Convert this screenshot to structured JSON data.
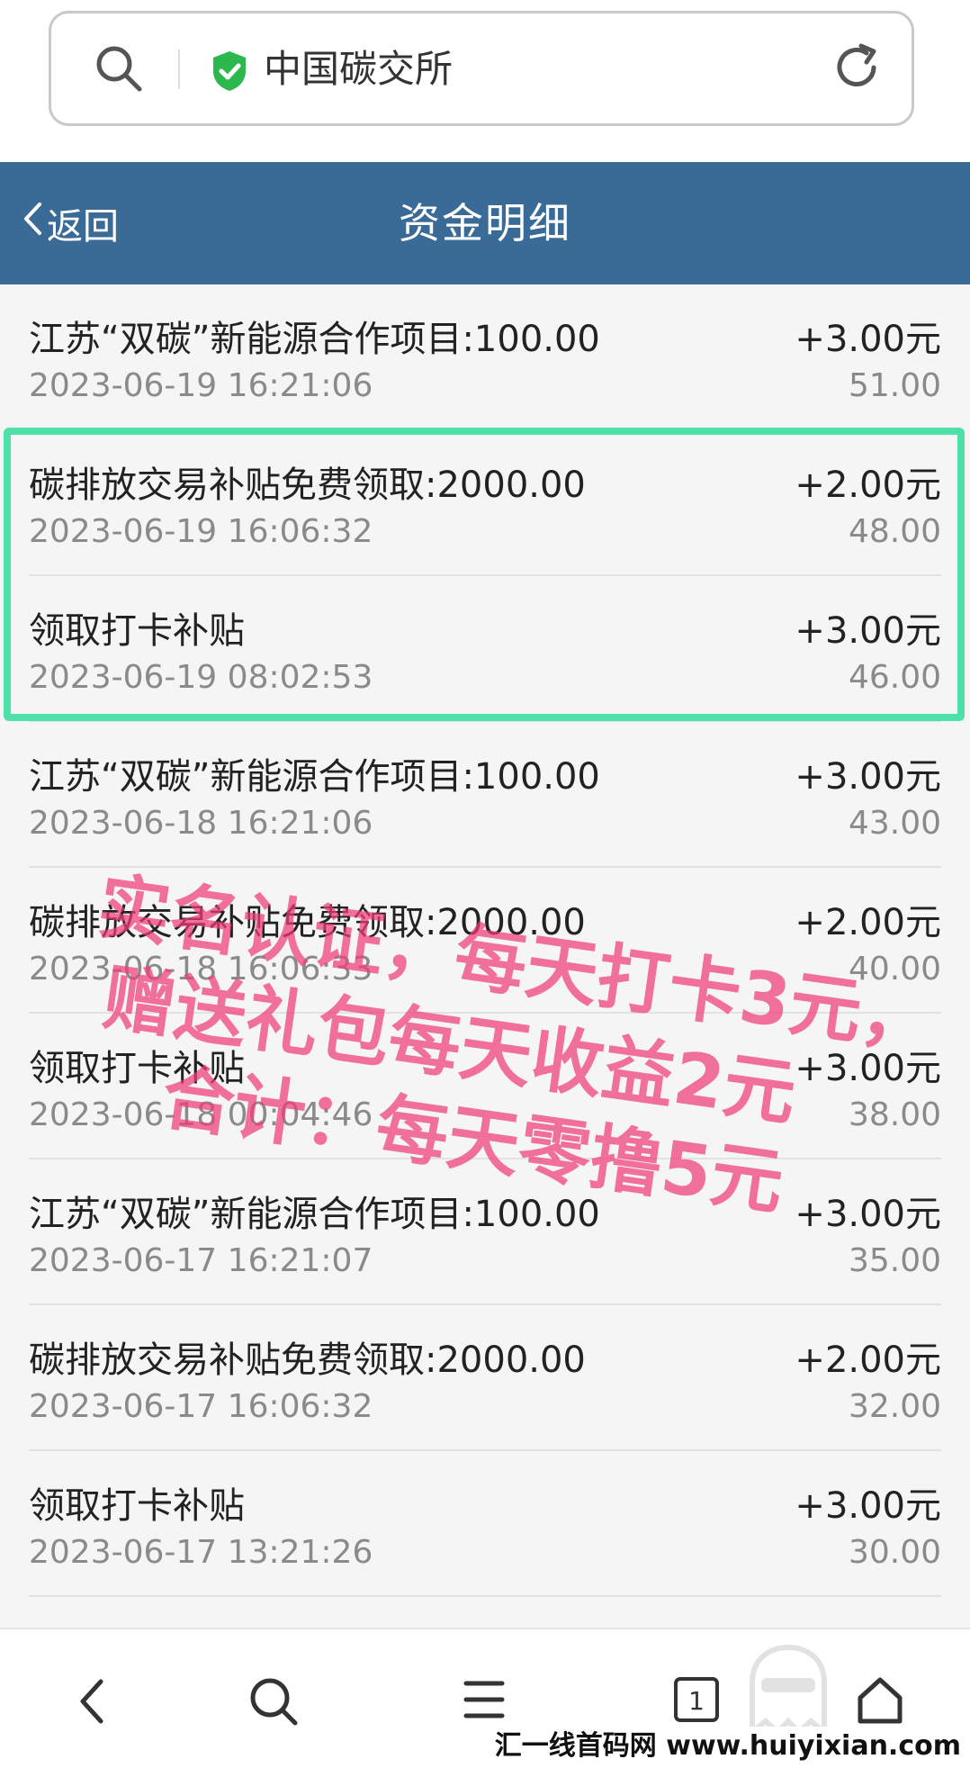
{
  "browser": {
    "site_name": "中国碳交所"
  },
  "header": {
    "back_label": "返回",
    "title": "资金明细"
  },
  "records": [
    {
      "desc": "江苏“双碳”新能源合作项目:100.00",
      "amount": "+3.00元",
      "time": "2023-06-19 16:21:06",
      "balance": "51.00"
    },
    {
      "desc": "碳排放交易补贴免费领取:2000.00",
      "amount": "+2.00元",
      "time": "2023-06-19 16:06:32",
      "balance": "48.00"
    },
    {
      "desc": "领取打卡补贴",
      "amount": "+3.00元",
      "time": "2023-06-19 08:02:53",
      "balance": "46.00"
    },
    {
      "desc": "江苏“双碳”新能源合作项目:100.00",
      "amount": "+3.00元",
      "time": "2023-06-18 16:21:06",
      "balance": "43.00"
    },
    {
      "desc": "碳排放交易补贴免费领取:2000.00",
      "amount": "+2.00元",
      "time": "2023-06-18 16:06:33",
      "balance": "40.00"
    },
    {
      "desc": "领取打卡补贴",
      "amount": "+3.00元",
      "time": "2023-06-18 00:04:46",
      "balance": "38.00"
    },
    {
      "desc": "江苏“双碳”新能源合作项目:100.00",
      "amount": "+3.00元",
      "time": "2023-06-17 16:21:07",
      "balance": "35.00"
    },
    {
      "desc": "碳排放交易补贴免费领取:2000.00",
      "amount": "+2.00元",
      "time": "2023-06-17 16:06:32",
      "balance": "32.00"
    },
    {
      "desc": "领取打卡补贴",
      "amount": "+3.00元",
      "time": "2023-06-17 13:21:26",
      "balance": "30.00"
    }
  ],
  "annotation": {
    "line1": "实名认证，每天打卡3元，",
    "line2": "赠送礼包每天收益2元",
    "line3": "合计：每天零撸5元"
  },
  "bottom_nav": {
    "tab_count": "1"
  },
  "footer": {
    "site_text": "汇一线首码网 www.huiyixian.com"
  },
  "colors": {
    "header_bg": "#3a6b96",
    "highlight_border": "#4fe0a9",
    "annotation": "#ee3c78",
    "shield": "#2db84d"
  },
  "icons": [
    "search-icon",
    "shield-check-icon",
    "reload-icon",
    "chevron-left-icon",
    "back-icon",
    "menu-icon",
    "tabs-icon",
    "home-icon"
  ]
}
